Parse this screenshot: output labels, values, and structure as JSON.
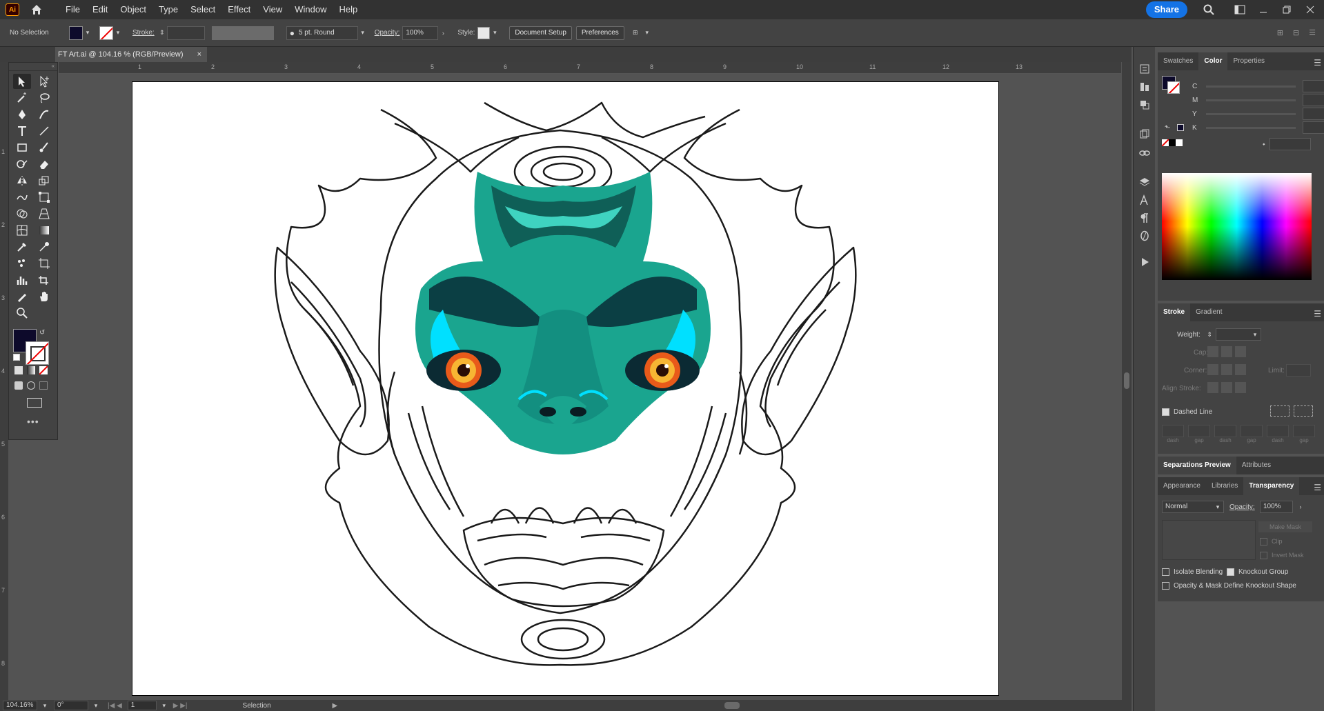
{
  "app": {
    "logo": "Ai"
  },
  "menu": [
    "File",
    "Edit",
    "Object",
    "Type",
    "Select",
    "Effect",
    "View",
    "Window",
    "Help"
  ],
  "share_label": "Share",
  "control_bar": {
    "selection": "No Selection",
    "stroke_label": "Stroke:",
    "brush_label": "5 pt. Round",
    "opacity_label": "Opacity:",
    "opacity_value": "100%",
    "style_label": "Style:",
    "document_setup": "Document Setup",
    "preferences": "Preferences"
  },
  "document_tab": {
    "title": "FT Art.ai @ 104.16 % (RGB/Preview)",
    "close": "×"
  },
  "rulers": {
    "horizontal": [
      "1",
      "2",
      "3",
      "4",
      "5",
      "6",
      "7",
      "8",
      "9",
      "10",
      "11",
      "12",
      "13"
    ],
    "vertical": [
      "1",
      "2",
      "3",
      "4",
      "5",
      "6",
      "7",
      "8"
    ]
  },
  "status_bar": {
    "zoom": "104.16%",
    "rotation": "0°",
    "artboard": "1",
    "tool": "Selection"
  },
  "color_panel": {
    "tabs": [
      "Swatches",
      "Color",
      "Properties"
    ],
    "active_tab": "Color",
    "channels": [
      "C",
      "M",
      "Y",
      "K"
    ],
    "unit": "%"
  },
  "stroke_panel": {
    "tabs": [
      "Stroke",
      "Gradient"
    ],
    "weight_label": "Weight:",
    "cap_label": "Cap:",
    "corner_label": "Corner:",
    "limit_label": "Limit:",
    "align_label": "Align Stroke:",
    "dashed_line": "Dashed Line",
    "dash_labels": [
      "dash",
      "gap",
      "dash",
      "gap",
      "dash",
      "gap"
    ]
  },
  "sep_panel": {
    "tabs": [
      "Separations Preview",
      "Attributes"
    ]
  },
  "transparency_panel": {
    "tabs": [
      "Appearance",
      "Libraries",
      "Transparency"
    ],
    "blend_mode": "Normal",
    "opacity_label": "Opacity:",
    "opacity_value": "100%",
    "make_mask": "Make Mask",
    "clip": "Clip",
    "invert_mask": "Invert Mask",
    "isolate": "Isolate Blending",
    "knockout": "Knockout Group",
    "define_knockout": "Opacity & Mask Define Knockout Shape"
  },
  "colors": {
    "fill": "#0d0a2b",
    "teal": "#1aa58f",
    "accent": "#1473e6"
  }
}
